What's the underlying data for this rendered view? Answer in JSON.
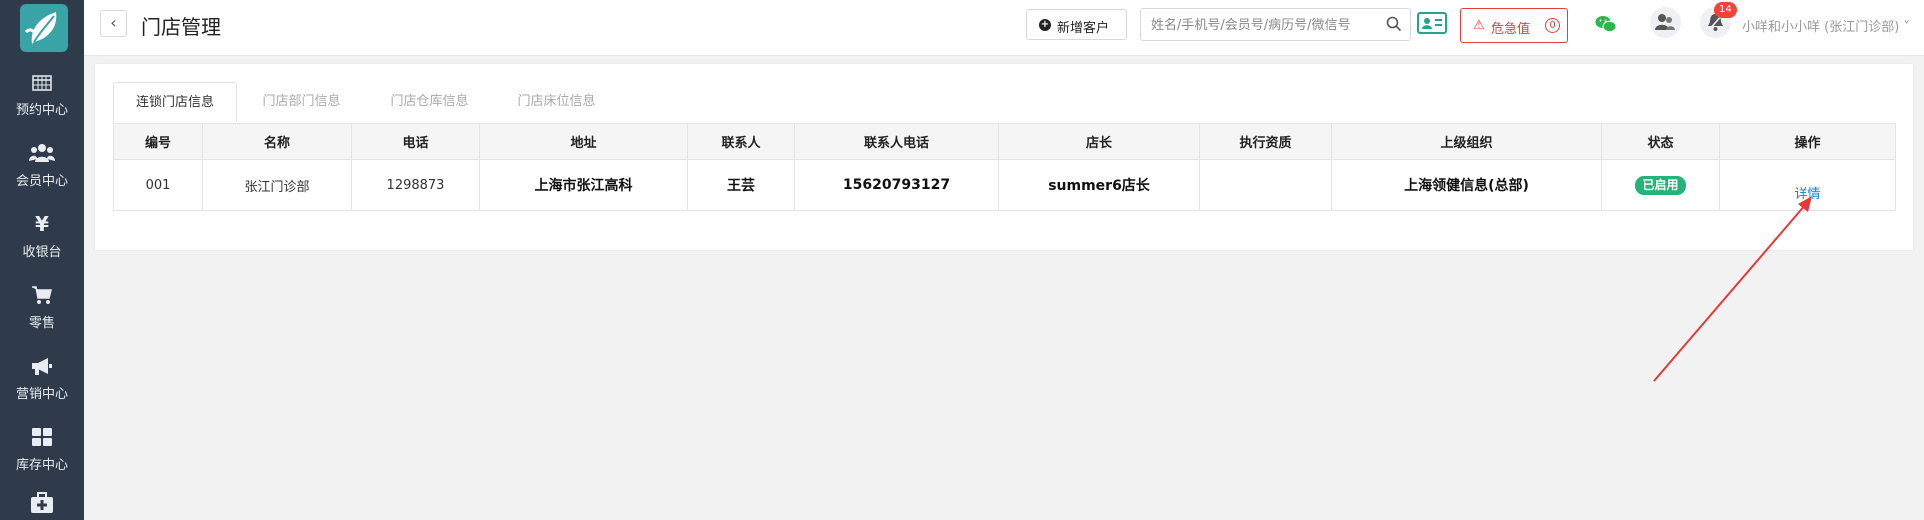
{
  "sidebar": {
    "logo_icon": "leaf-logo-icon",
    "items": [
      {
        "label": "预约中心",
        "icon": "calendar-grid-icon"
      },
      {
        "label": "会员中心",
        "icon": "users-icon"
      },
      {
        "label": "收银台",
        "icon": "yen-icon"
      },
      {
        "label": "零售",
        "icon": "cart-icon"
      },
      {
        "label": "营销中心",
        "icon": "megaphone-icon"
      },
      {
        "label": "库存中心",
        "icon": "grid-icon"
      },
      {
        "label": "",
        "icon": "medkit-icon"
      }
    ]
  },
  "header": {
    "back_icon": "‹",
    "title": "门店管理",
    "new_customer_label": "新增客户",
    "search_placeholder": "姓名/手机号/会员号/病历号/微信号",
    "danger_label": "危急值",
    "danger_count": "0",
    "notification_count": "14",
    "user_name": "小咩和小小咩 (张江门诊部)"
  },
  "tabs": [
    {
      "label": "连锁门店信息",
      "active": true
    },
    {
      "label": "门店部门信息",
      "active": false
    },
    {
      "label": "门店仓库信息",
      "active": false
    },
    {
      "label": "门店床位信息",
      "active": false
    }
  ],
  "table": {
    "headers": [
      "编号",
      "名称",
      "电话",
      "地址",
      "联系人",
      "联系人电话",
      "店长",
      "执行资质",
      "上级组织",
      "状态",
      "操作"
    ],
    "rows": [
      {
        "code": "001",
        "name": "张江门诊部",
        "phone": "1298873",
        "address": "上海市张江高科",
        "contact": "王芸",
        "contact_phone": "15620793127",
        "manager": "summer6店长",
        "qualification": "",
        "parent_org": "上海领健信息(总部)",
        "status": "已启用",
        "action": "详情"
      }
    ]
  },
  "colors": {
    "sidebar_bg": "#2f3b4a",
    "accent_green": "#24b37a",
    "danger_red": "#e0413b",
    "link_blue": "#1e7fd0",
    "annotation_arrow": "#e53935"
  }
}
